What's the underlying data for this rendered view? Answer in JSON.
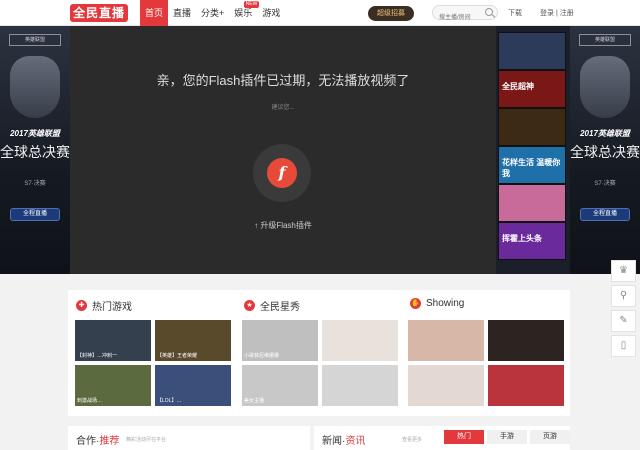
{
  "header": {
    "logo": "全民直播",
    "nav": [
      {
        "label": "首页",
        "active": true
      },
      {
        "label": "直播"
      },
      {
        "label": "分类+"
      },
      {
        "label": "娱乐",
        "badge": "NEW"
      },
      {
        "label": "游戏"
      }
    ],
    "recruit_label": "超级招募",
    "search_placeholder": "搜主播/房间",
    "download_label": "下载",
    "login_label": "登录 | 注册"
  },
  "banner": {
    "side_badge": "英雄联盟",
    "side_title": "2017英雄联盟",
    "side_big": "全球总决赛",
    "side_sub": "S7·决赛",
    "side_button": "全程直播"
  },
  "player": {
    "message": "亲，您的Flash插件已过期，无法播放视频了",
    "hint": "建议您...",
    "flash_glyph": "f",
    "upgrade_label": "↑ 升级Flash插件"
  },
  "thumbs": [
    {
      "text": "",
      "color": "#2c3b5a"
    },
    {
      "text": "全民超神",
      "color": "#7a1818"
    },
    {
      "text": "",
      "color": "#3d2a14"
    },
    {
      "text": "花样生活 温暖你我",
      "color": "#1f6fa8"
    },
    {
      "text": "",
      "color": "#c86a9a"
    },
    {
      "text": "挥霍上头条",
      "color": "#6a2a9c"
    }
  ],
  "right_tools": [
    "♛",
    "⚲",
    "✎",
    "▯"
  ],
  "sections": {
    "games_title": "热门游戏",
    "stars_title": "全民星秀",
    "showing_title": "Showing",
    "games": [
      {
        "caption": "【封神】…冲刺一",
        "color": "#35404f"
      },
      {
        "caption": "【英雄】王者荣耀",
        "color": "#5a4a2c"
      },
      {
        "caption": "刺激战场…",
        "color": "#5b6b3f"
      },
      {
        "caption": "【LOL】…",
        "color": "#3a4f7a"
      }
    ],
    "stars": [
      {
        "caption": "小歌菲尼维娜娜",
        "color": "#bfbfbf"
      },
      {
        "caption": "",
        "color": "#e9e1dc"
      },
      {
        "caption": "美女主播",
        "color": "#c8c8c8"
      },
      {
        "caption": "",
        "color": "#d5d5d5"
      }
    ],
    "showing": [
      {
        "caption": "",
        "color": "#d6b7a8"
      },
      {
        "caption": "",
        "color": "#2b2420"
      },
      {
        "caption": "",
        "color": "#e4d8d2"
      },
      {
        "caption": "",
        "color": "#b9343c"
      }
    ]
  },
  "lower": {
    "coop_title": "合作·",
    "coop_accent": "推荐",
    "coop_sub": "精彩活动尽在平台",
    "news_title": "新闻·",
    "news_accent": "资讯",
    "news_more": "查看更多",
    "tabs": [
      "热门",
      "手游",
      "页游"
    ]
  },
  "colors": {
    "brand": "#e4393c",
    "stage": "#1a1f2a"
  }
}
